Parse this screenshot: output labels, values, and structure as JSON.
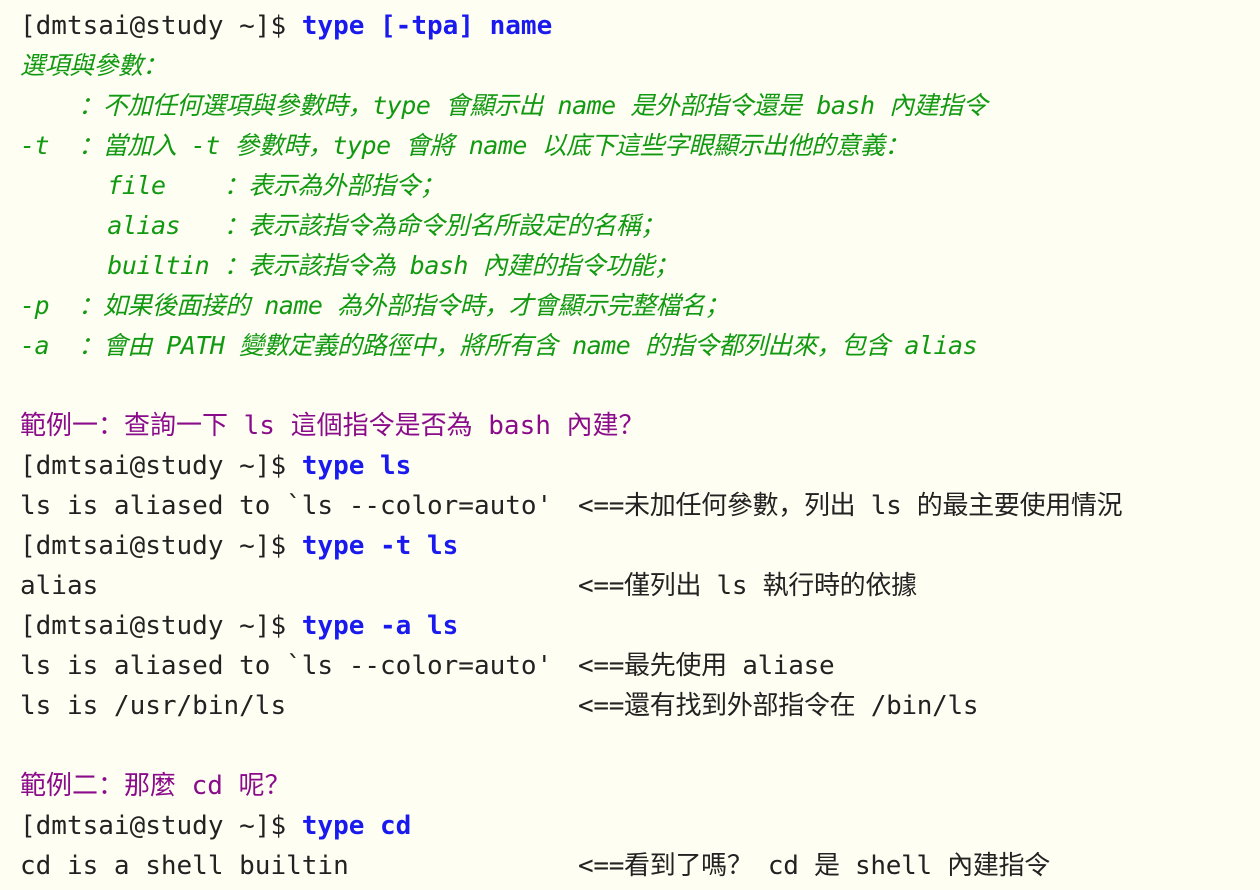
{
  "prompt": "[dmtsai@study ~]$ ",
  "syntax": {
    "command": "type [-tpa] name"
  },
  "options": {
    "heading": "選項與參數：",
    "lines": [
      "    ：不加任何選項與參數時，type 會顯示出 name 是外部指令還是 bash 內建指令",
      "-t  ：當加入 -t 參數時，type 會將 name 以底下這些字眼顯示出他的意義：",
      "      file    ：表示為外部指令；",
      "      alias   ：表示該指令為命令別名所設定的名稱；",
      "      builtin ：表示該指令為 bash 內建的指令功能；",
      "-p  ：如果後面接的 name 為外部指令時，才會顯示完整檔名；",
      "-a  ：會由 PATH 變數定義的路徑中，將所有含 name 的指令都列出來，包含 alias"
    ]
  },
  "example1": {
    "title": "範例一：查詢一下 ls 這個指令是否為 bash 內建？",
    "cmd1": "type ls",
    "out1_text": "ls is aliased to `ls --color=auto' ",
    "out1_note": "<==未加任何參數，列出 ls 的最主要使用情況",
    "cmd2": "type -t ls",
    "out2_text": "alias",
    "out2_note": "<==僅列出 ls 執行時的依據",
    "cmd3": "type -a ls",
    "out3a_text": "ls is aliased to `ls --color=auto' ",
    "out3a_note": "<==最先使用 aliase",
    "out3b_text": "ls is /usr/bin/ls",
    "out3b_note": "<==還有找到外部指令在 /bin/ls"
  },
  "example2": {
    "title": "範例二：那麼 cd 呢？",
    "cmd1": "type cd",
    "out1_text": "cd is a shell builtin",
    "out1_note": "<==看到了嗎？ cd 是 shell 內建指令"
  },
  "colors": {
    "background": "#fefef2",
    "command": "#1a1aee",
    "options": "#129912",
    "example_title": "#8a0c8a",
    "text": "#222222"
  }
}
